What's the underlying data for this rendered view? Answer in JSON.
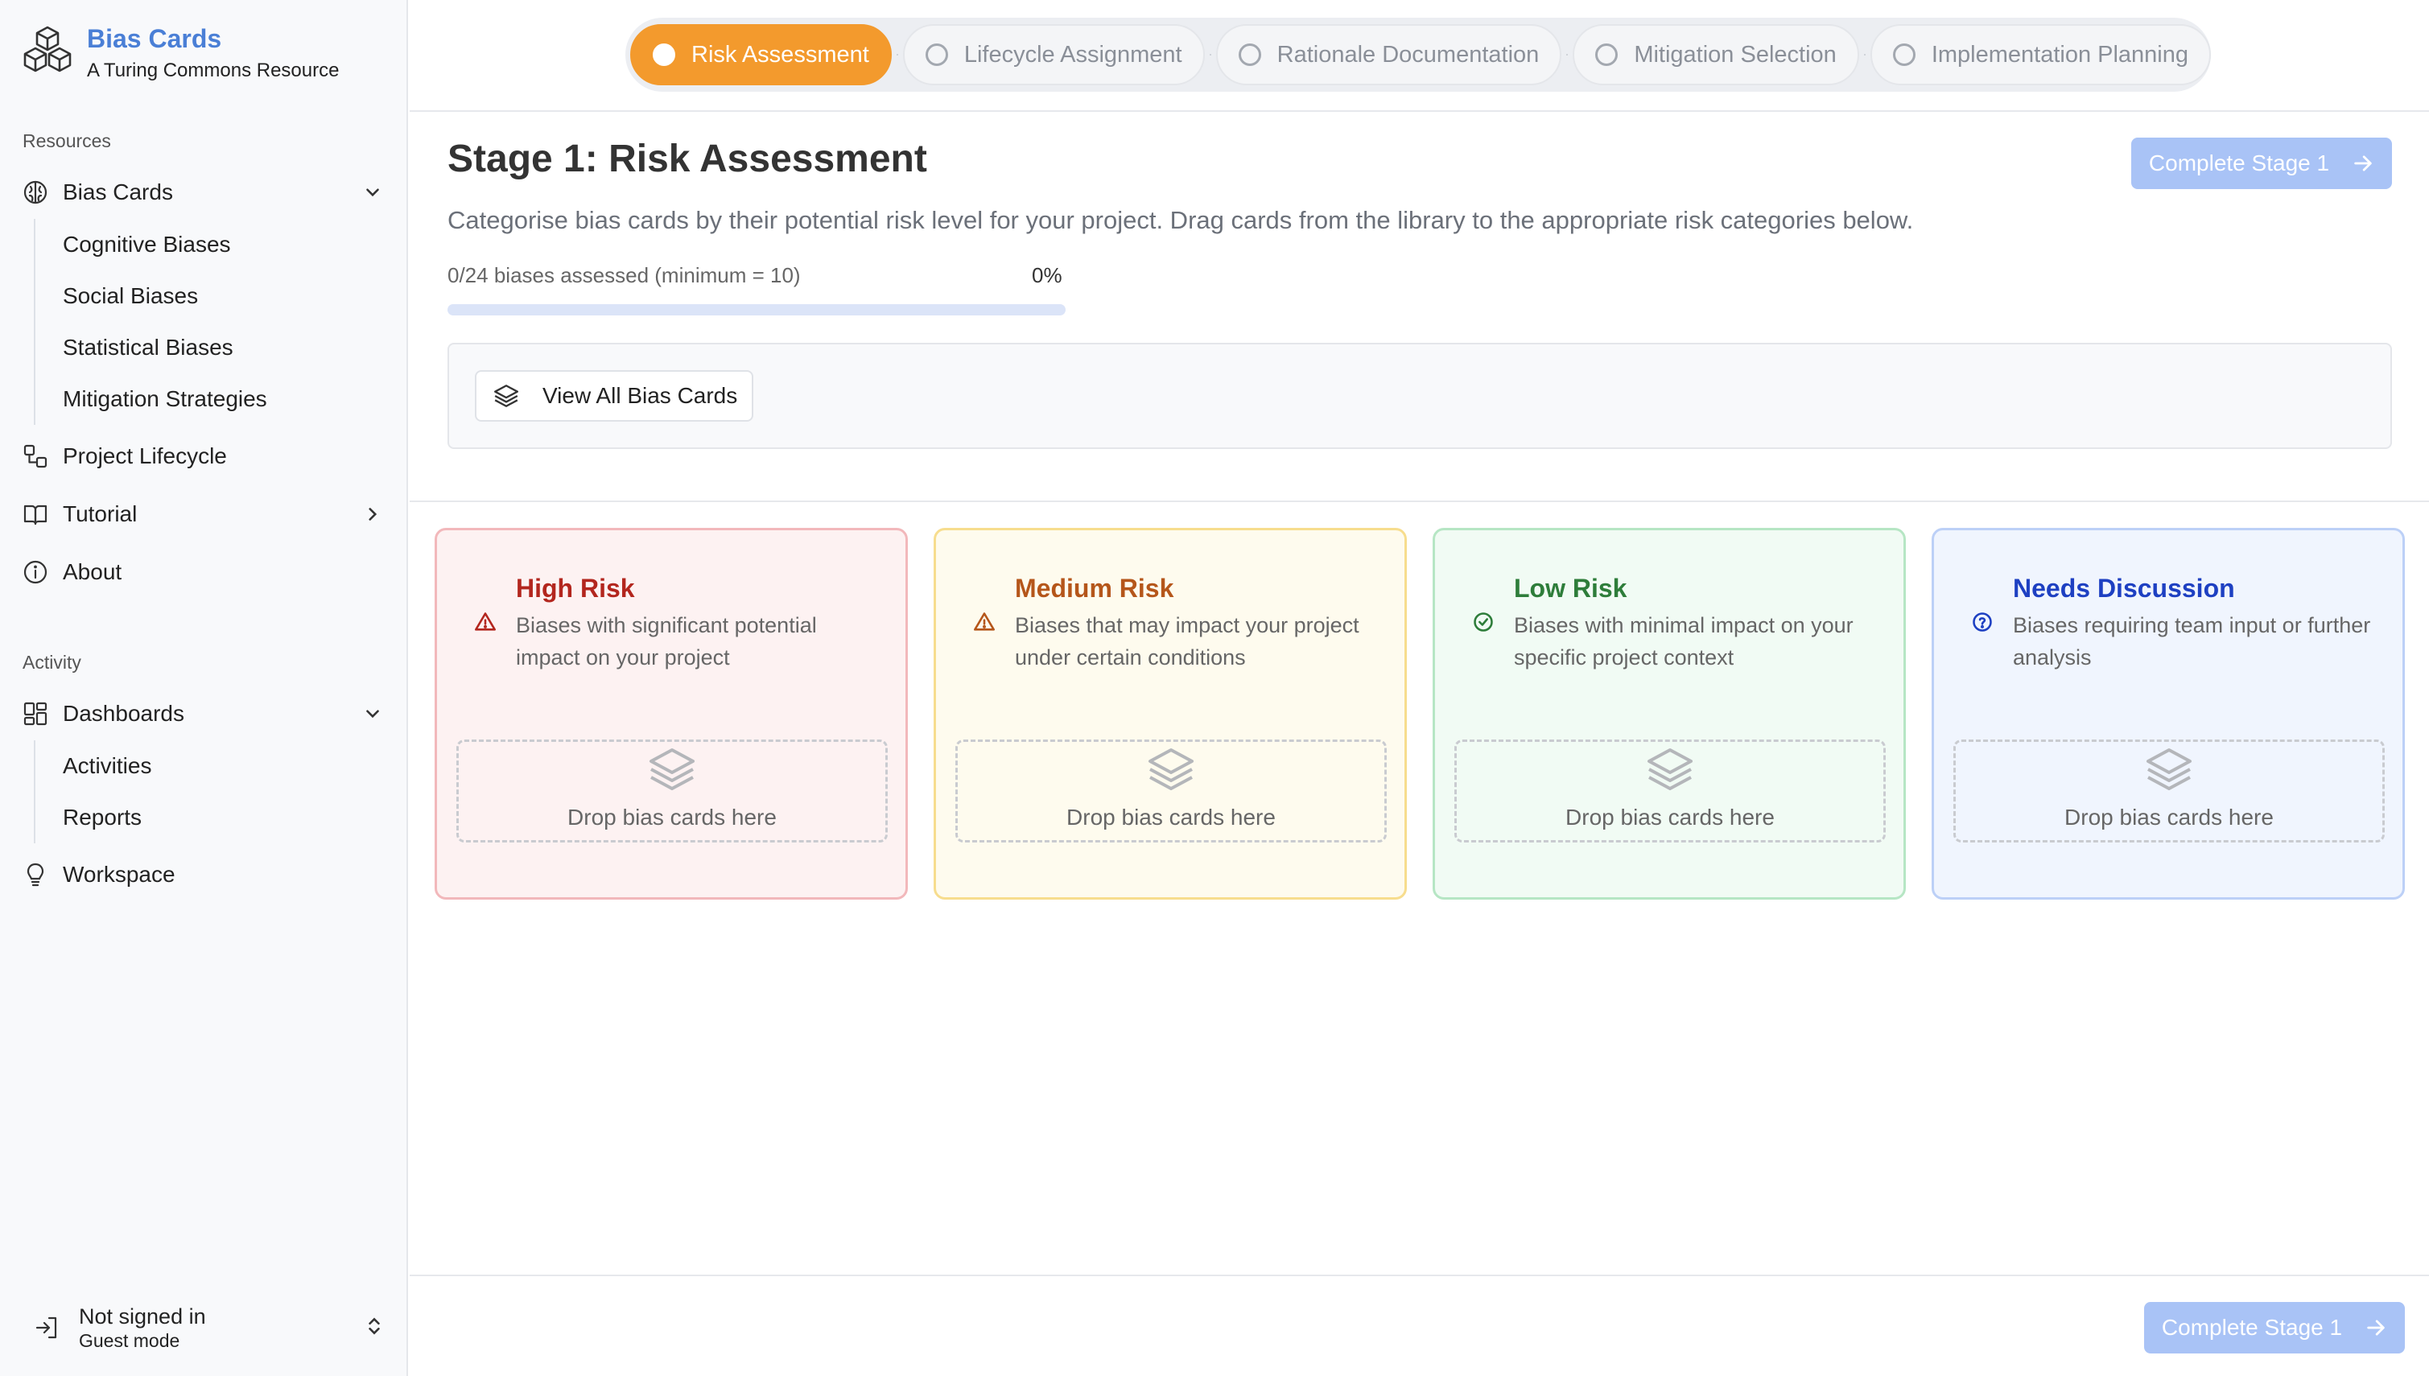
{
  "brand": {
    "title": "Bias Cards",
    "subtitle": "A Turing Commons Resource"
  },
  "sidebar": {
    "resources_label": "Resources",
    "bias_cards": {
      "label": "Bias Cards",
      "items": [
        "Cognitive Biases",
        "Social Biases",
        "Statistical Biases",
        "Mitigation Strategies"
      ]
    },
    "project_lifecycle": "Project Lifecycle",
    "tutorial": "Tutorial",
    "about": "About",
    "activity_label": "Activity",
    "dashboards": {
      "label": "Dashboards",
      "items": [
        "Activities",
        "Reports"
      ]
    },
    "workspace": "Workspace",
    "user": {
      "name": "Not signed in",
      "mode": "Guest mode"
    }
  },
  "stepper": {
    "steps": [
      "Risk Assessment",
      "Lifecycle Assignment",
      "Rationale Documentation",
      "Mitigation Selection",
      "Implementation Planning"
    ],
    "active_index": 0
  },
  "stage": {
    "title": "Stage 1: Risk Assessment",
    "description": "Categorise bias cards by their potential risk level for your project. Drag cards from the library to the appropriate risk categories below.",
    "complete_label": "Complete Stage 1",
    "progress_label": "0/24 biases assessed (minimum = 10)",
    "progress_pct_label": "0%",
    "progress_fraction": 0,
    "view_all_label": "View All Bias Cards"
  },
  "risk_columns": [
    {
      "title": "High Risk",
      "description": "Biases with significant potential impact on your project",
      "drop_label": "Drop bias cards here",
      "icon": "warning-triangle-icon",
      "accent": "#b3261e",
      "border": "#f2b8bb",
      "bg": "#fdf2f2"
    },
    {
      "title": "Medium Risk",
      "description": "Biases that may impact your project under certain conditions",
      "drop_label": "Drop bias cards here",
      "icon": "warning-triangle-icon",
      "accent": "#b5561a",
      "border": "#f7dd8e",
      "bg": "#fefbee"
    },
    {
      "title": "Low Risk",
      "description": "Biases with minimal impact on your specific project context",
      "drop_label": "Drop bias cards here",
      "icon": "check-circle-icon",
      "accent": "#2e7d3a",
      "border": "#b6e6c4",
      "bg": "#f1fbf4"
    },
    {
      "title": "Needs Discussion",
      "description": "Biases requiring team input or further analysis",
      "drop_label": "Drop bias cards here",
      "icon": "question-circle-icon",
      "accent": "#1e40c2",
      "border": "#bcd0f7",
      "bg": "#f0f5fe"
    }
  ],
  "colors": {
    "brand": "#4a7fd6",
    "active_step": "#f39a2d",
    "button_disabled": "#a9c3f6"
  }
}
